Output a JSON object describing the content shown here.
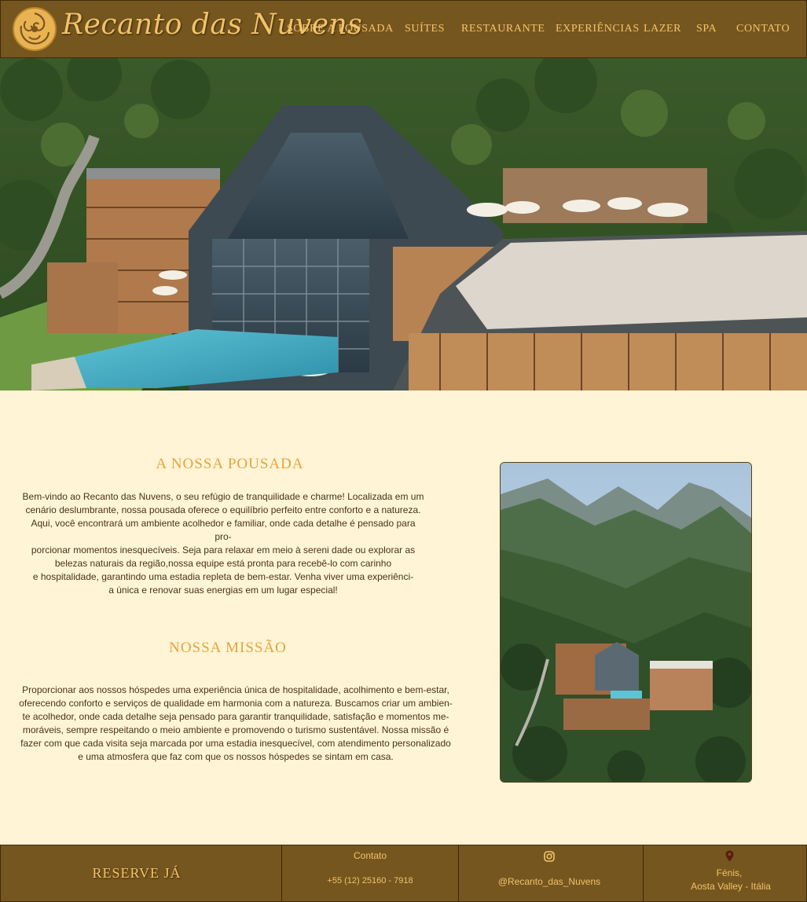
{
  "header": {
    "brand": "Recanto das Nuvens",
    "nav": [
      "Sobre a Pousada",
      "Suítes",
      "Restaurante",
      "Experiências",
      "Lazer",
      "SPA",
      "Contato"
    ]
  },
  "about": {
    "title": "A NOSSA POUSADA",
    "lines": [
      "Bem-vindo ao Recanto das Nuvens, o seu refúgio de tranquilidade e charme! Localizada em um",
      "cenário deslumbrante, nossa pousada oferece o equilíbrio perfeito entre conforto e a natureza.",
      "Aqui, você encontrará um ambiente acolhedor e familiar, onde cada detalhe é pensado para pro-",
      "porcionar momentos inesquecíveis. Seja para relaxar em meio à sereni dade ou explorar as",
      "belezas naturais da região,nossa equipe está pronta para recebê-lo com carinho",
      "e hospitalidade, garantindo uma estadia repleta de bem-estar. Venha viver uma experiênci-",
      "a única e renovar suas energias em um lugar especial!"
    ]
  },
  "mission": {
    "title": "NOSSA MISSÃO",
    "lines": [
      "Proporcionar aos nossos hóspedes uma experiência única de hospitalidade, acolhimento e bem-estar,",
      "oferecendo conforto e serviços de qualidade em harmonia com a natureza. Buscamos criar um ambien-",
      "te acolhedor, onde cada detalhe seja pensado para garantir tranquilidade, satisfação e momentos me-",
      "moráveis, sempre respeitando o meio ambiente e promovendo o turismo sustentável. Nossa missão é",
      "fazer com que cada visita seja marcada por uma estadia inesquecível, com atendimento personalizado",
      "e uma atmosfera que faz com que os nossos hóspedes se sintam em casa."
    ]
  },
  "footer": {
    "reserve": "RESERVE JÁ",
    "contact_label": "Contato",
    "phone": "+55 (12) 25160 - 7918",
    "instagram": "@Recanto_das_Nuvens",
    "location_line1": "Fénis,",
    "location_line2": "Aosta Valley -  Itália"
  },
  "colors": {
    "header_bg": "#76561f",
    "page_bg": "#fff5d6",
    "accent_gold": "#f4c46b",
    "title_orange": "#e5a33c",
    "body_text": "#4a3218"
  },
  "icons": [
    "flower-logo-icon",
    "instagram-icon",
    "location-pin-icon"
  ]
}
